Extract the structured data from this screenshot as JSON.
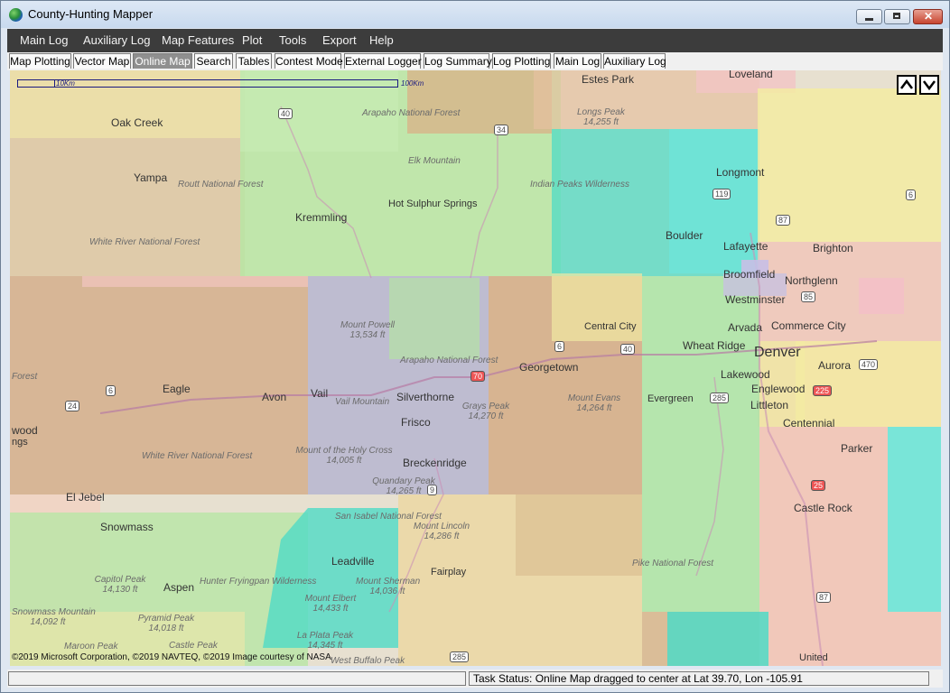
{
  "window": {
    "title": "County-Hunting Mapper",
    "icon": "globe-icon"
  },
  "menu": [
    "Main Log",
    "Auxiliary Log",
    "Map Features",
    "Plot",
    "Tools",
    "Export",
    "Help"
  ],
  "tabs": [
    "Map Plotting",
    "Vector Map",
    "Online Map",
    "Search",
    "Tables",
    "Contest Mode",
    "External Logger",
    "Log Summary",
    "Log Plotting",
    "Main Log",
    "Auxiliary Log"
  ],
  "active_tab": "Online Map",
  "map": {
    "scale_short": "10Km",
    "scale_long": "100Km",
    "copyright": "©2019 Microsoft Corporation, ©2019 NAVTEQ, ©2019 Image courtesy of NASA",
    "nav_up_icon": "chevron-up-icon",
    "nav_down_icon": "chevron-down-icon",
    "labels": {
      "loveland": "Loveland",
      "estes_park": "Estes Park",
      "longs_peak": "Longs Peak",
      "longs_peak_elev": "14,255 ft",
      "oak_creek": "Oak Creek",
      "yampa": "Yampa",
      "routt_nf": "Routt National Forest",
      "arapaho_nf": "Arapaho National Forest",
      "elk_mountain": "Elk Mountain",
      "indian_peaks": "Indian Peaks Wilderness",
      "longmont": "Longmont",
      "hot_sulphur": "Hot Sulphur Springs",
      "kremmling": "Kremmling",
      "white_river_nf": "White River National Forest",
      "boulder": "Boulder",
      "lafayette": "Lafayette",
      "brighton": "Brighton",
      "broomfield": "Broomfield",
      "northglenn": "Northglenn",
      "westminster": "Westminster",
      "commerce_city": "Commerce City",
      "mount_powell": "Mount Powell",
      "mount_powell_elev": "13,534 ft",
      "central_city": "Central City",
      "arvada": "Arvada",
      "wheat_ridge": "Wheat Ridge",
      "denver": "Denver",
      "arapaho_nf2": "Arapaho National Forest",
      "georgetown": "Georgetown",
      "aurora": "Aurora",
      "lakewood": "Lakewood",
      "forest_left": "Forest",
      "eagle": "Eagle",
      "avon": "Avon",
      "vail": "Vail",
      "vail_mountain": "Vail Mountain",
      "silverthorne": "Silverthorne",
      "mount_evans": "Mount Evans",
      "mount_evans_elev": "14,264 ft",
      "evergreen": "Evergreen",
      "englewood": "Englewood",
      "littleton": "Littleton",
      "grays_peak": "Grays Peak",
      "grays_peak_elev": "14,270 ft",
      "frisco": "Frisco",
      "centennial": "Centennial",
      "wood": "wood",
      "ngs": "ngs",
      "holy_cross": "Mount of the Holy Cross",
      "holy_cross_elev": "14,005 ft",
      "white_river_nf2": "White River National Forest",
      "breckenridge": "Breckenridge",
      "parker": "Parker",
      "quandary": "Quandary Peak",
      "quandary_elev": "14,265 ft",
      "el_jebel": "El Jebel",
      "castle_rock": "Castle Rock",
      "snowmass": "Snowmass",
      "san_isabel": "San Isabel National Forest",
      "mount_lincoln": "Mount Lincoln",
      "mount_lincoln_elev": "14,286 ft",
      "leadville": "Leadville",
      "fairplay": "Fairplay",
      "pike_nf": "Pike National Forest",
      "capitol_peak": "Capitol Peak",
      "capitol_peak_elev": "14,130 ft",
      "aspen": "Aspen",
      "hunter_fryingpan": "Hunter Fryingpan Wilderness",
      "mount_sherman": "Mount Sherman",
      "mount_sherman_elev": "14,036 ft",
      "mount_elbert": "Mount Elbert",
      "mount_elbert_elev": "14,433 ft",
      "snowmass_mtn": "Snowmass Mountain",
      "snowmass_mtn_elev": "14,092 ft",
      "pyramid_peak": "Pyramid Peak",
      "pyramid_peak_elev": "14,018 ft",
      "la_plata": "La Plata Peak",
      "la_plata_elev": "14,345 ft",
      "maroon_peak": "Maroon Peak",
      "castle_peak": "Castle Peak",
      "west_buffalo": "West Buffalo Peak",
      "united": "United"
    },
    "roads": [
      "40",
      "34",
      "119",
      "6",
      "87",
      "85",
      "36",
      "70",
      "40",
      "6",
      "470",
      "24",
      "6",
      "285",
      "225",
      "9",
      "25",
      "87",
      "285"
    ]
  },
  "status": {
    "left": "",
    "right": "Task Status: Online Map dragged to center at Lat 39.70, Lon -105.91"
  }
}
